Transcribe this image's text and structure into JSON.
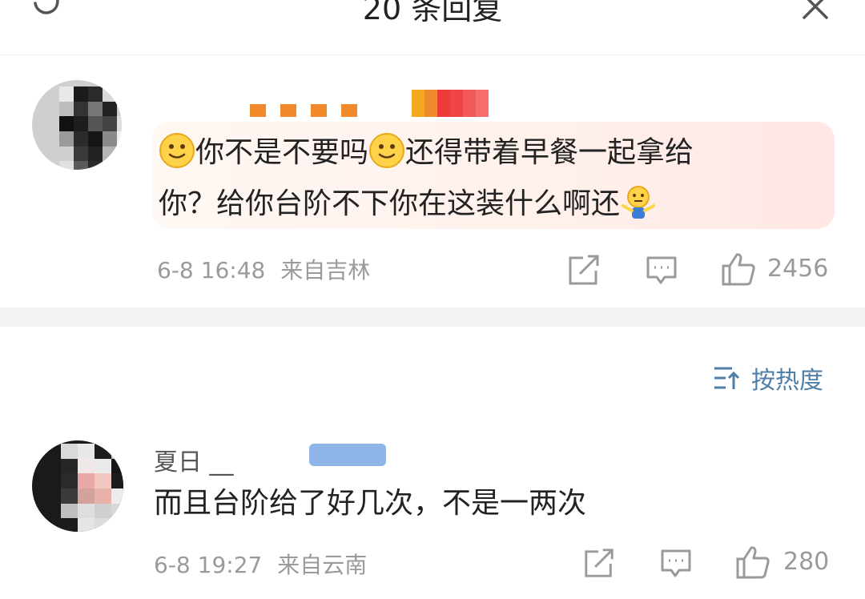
{
  "header": {
    "title": "20 条回复",
    "refresh_icon": "refresh-icon",
    "close_icon": "close-icon"
  },
  "main_comment": {
    "text_part1": "你不是不要吗",
    "text_part2": "还得带着早餐一起拿给",
    "text_line2": "你？给你台阶不下你在这装什么啊还",
    "time": "6-8 16:48",
    "location": "来自吉林",
    "likes": "2456",
    "emoji": [
      "smile-emoji",
      "smile-emoji",
      "shrug-emoji"
    ]
  },
  "sort": {
    "label": "按热度",
    "icon": "sort-icon"
  },
  "reply": {
    "username": "夏日 __",
    "text": "而且台阶给了好几次，不是一两次",
    "time": "6-8 19:27",
    "location": "来自云南",
    "likes": "280"
  },
  "colors": {
    "accent_blue": "#4f7fa8",
    "meta_gray": "#9a9a9a",
    "bubble": "#fff1ec"
  }
}
